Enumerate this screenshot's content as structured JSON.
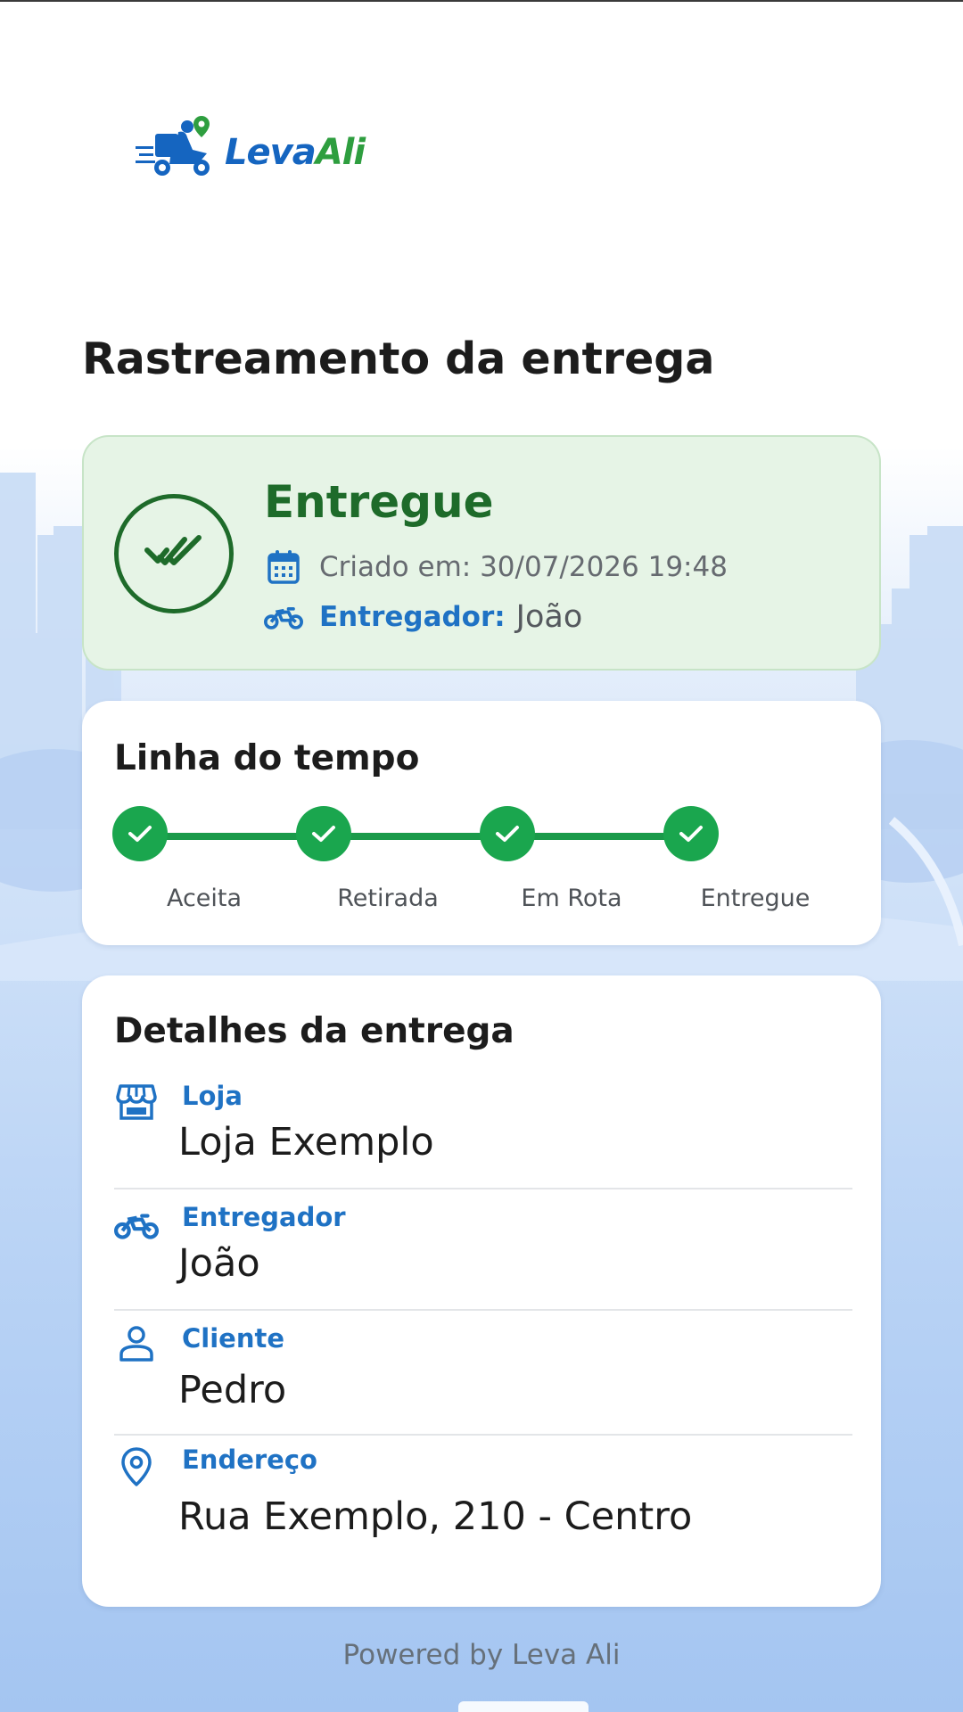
{
  "brand": {
    "logo_part1": "Leva",
    "logo_part2": "Ali",
    "colors": {
      "primary": "#1565c0",
      "accent": "#2e9e3f"
    }
  },
  "page": {
    "title": "Rastreamento da entrega"
  },
  "status": {
    "label": "Entregue",
    "icon": "double-check-icon",
    "created_text": "Criado em: 30/07/2026 19:48",
    "created_icon": "calendar-icon",
    "courier_key": "Entregador:",
    "courier_value": "João",
    "courier_icon": "motorcycle-icon",
    "colors": {
      "background": "#e6f4e6",
      "text": "#1e6b2a"
    }
  },
  "timeline": {
    "title": "Linha do tempo",
    "steps": [
      {
        "label": "Aceita",
        "done": true
      },
      {
        "label": "Retirada",
        "done": true
      },
      {
        "label": "Em Rota",
        "done": true
      },
      {
        "label": "Entregue",
        "done": true
      }
    ],
    "color": "#1aa64e"
  },
  "details": {
    "title": "Detalhes da entrega",
    "items": [
      {
        "key": "Loja",
        "value": "Loja Exemplo",
        "icon": "store-icon"
      },
      {
        "key": "Entregador",
        "value": "João",
        "icon": "motorcycle-icon"
      },
      {
        "key": "Cliente",
        "value": "Pedro",
        "icon": "person-icon"
      },
      {
        "key": "Endereço",
        "value": "Rua Exemplo, 210 - Centro",
        "icon": "location-pin-icon"
      }
    ]
  },
  "footer": {
    "text": "Powered by Leva Ali"
  }
}
